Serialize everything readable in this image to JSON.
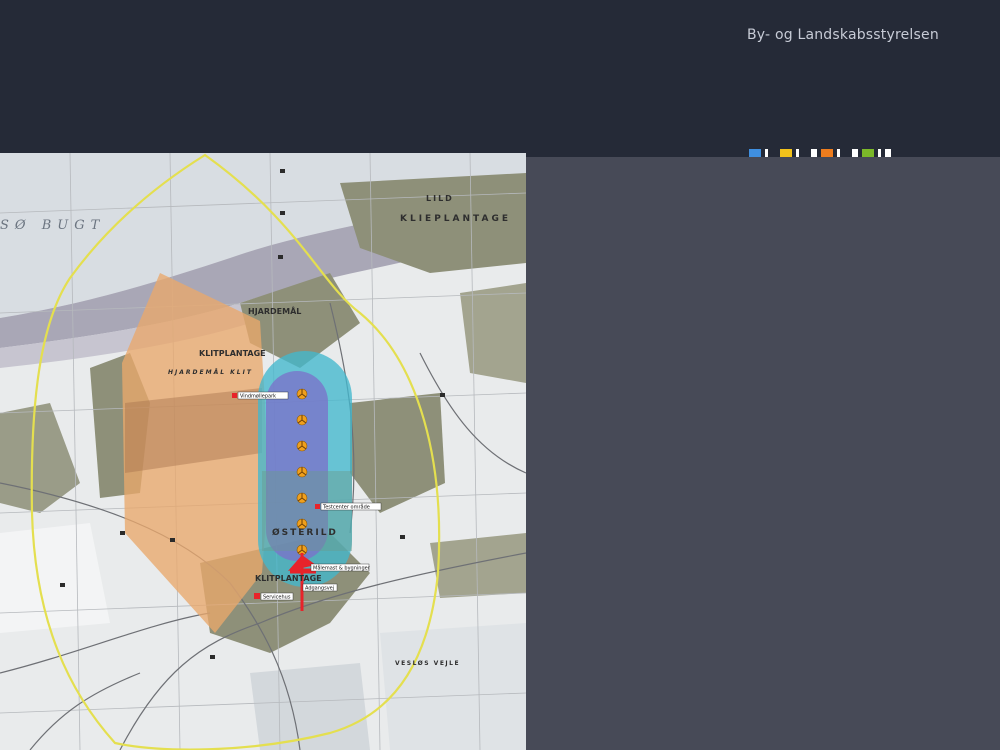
{
  "header": {
    "agency_name": "By- og Landskabsstyrelsen",
    "color_stripe": [
      "#3f8fe0",
      "#ffffff",
      "#f2c21b",
      "#ffffff",
      "#ffffff",
      "#ee7d1e",
      "#ffffff",
      "#ffffff",
      "#7bb829",
      "#ffffff",
      "#ffffff"
    ]
  },
  "map": {
    "place_labels": {
      "bay": "SØ BUGT",
      "klieplantage_ne": "KLIEPLANTAGE",
      "lild": "LILD",
      "hjardemal": "HJARDEMÅL",
      "klitplantage_w": "KLITPLANTAGE",
      "hjardemal_klit": "HJARDEMÅL KLIT",
      "osterild": "ØSTERILD",
      "klitplantage_s": "KLITPLANTAGE",
      "vejlerne": "VESLØS VEJLE"
    },
    "callouts": [
      "Vindmøllepark",
      "Testcenter område",
      "Målemast & bygninger",
      "Adgangsvej",
      "Servicehus"
    ],
    "turbine_count": 7,
    "colors": {
      "zone_boundary": "#e4df4f",
      "forest": "#8e9079",
      "restricted_area": "#e9a86b",
      "test_zone_outer": "#43b7cd",
      "test_zone_inner": "#7b72c9",
      "turbine": "#f0a01c",
      "infrastructure": "#e8232a"
    }
  }
}
